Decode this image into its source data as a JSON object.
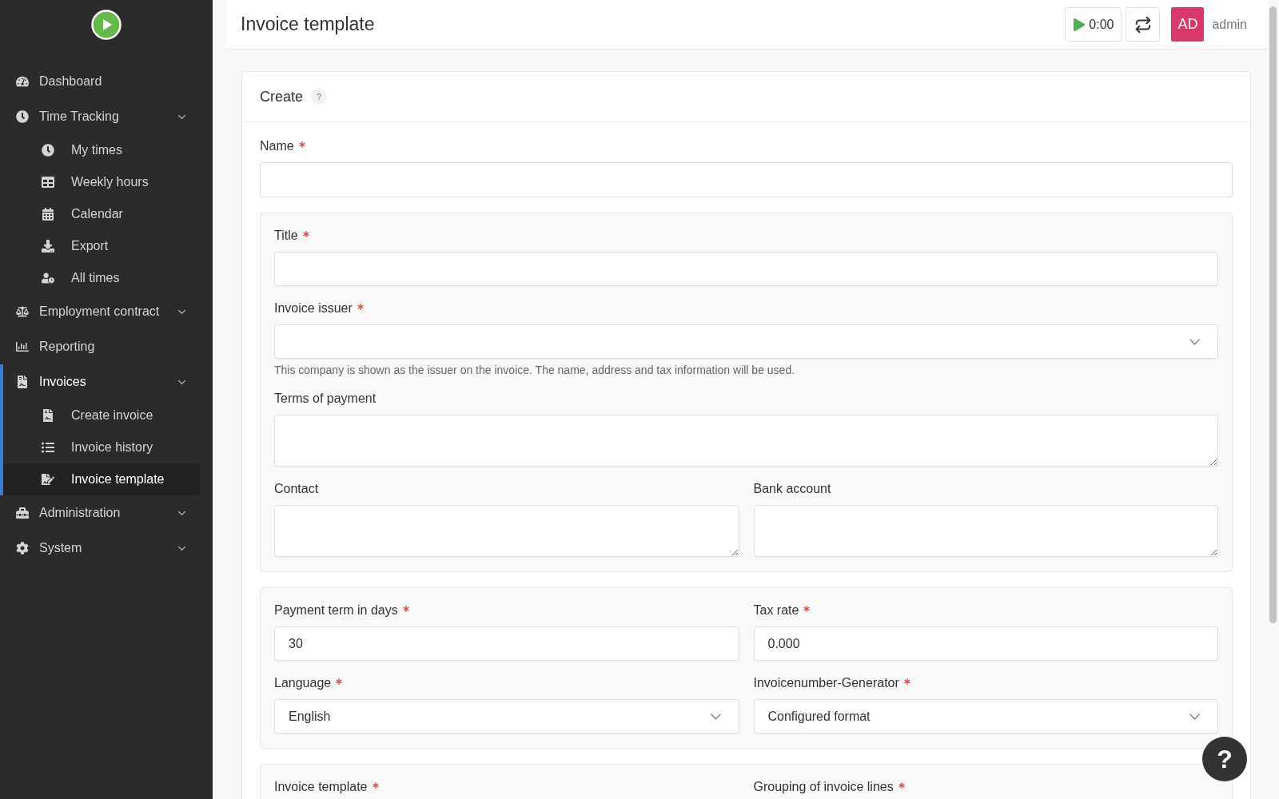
{
  "sidebar": {
    "items": [
      {
        "label": "Dashboard",
        "kind": "link",
        "selected": false
      },
      {
        "label": "Time Tracking",
        "kind": "group",
        "selected": false,
        "children": [
          {
            "label": "My times",
            "selected": false
          },
          {
            "label": "Weekly hours",
            "selected": false
          },
          {
            "label": "Calendar",
            "selected": false
          },
          {
            "label": "Export",
            "selected": false
          },
          {
            "label": "All times",
            "selected": false
          }
        ]
      },
      {
        "label": "Employment contract",
        "kind": "group",
        "selected": false
      },
      {
        "label": "Reporting",
        "kind": "link",
        "selected": false
      },
      {
        "label": "Invoices",
        "kind": "group",
        "selected": true,
        "children": [
          {
            "label": "Create invoice",
            "selected": false
          },
          {
            "label": "Invoice history",
            "selected": false
          },
          {
            "label": "Invoice template",
            "selected": true
          }
        ]
      },
      {
        "label": "Administration",
        "kind": "group",
        "selected": false
      },
      {
        "label": "System",
        "kind": "group",
        "selected": false
      }
    ]
  },
  "header": {
    "title": "Invoice template",
    "timer": "0:00",
    "avatar": "AD",
    "username": "admin"
  },
  "form": {
    "title": "Create",
    "help_badge": "?",
    "fields": [
      {
        "kind": "text",
        "label": "Name",
        "required": true
      }
    ],
    "groups": [
      {
        "rows": [
          [
            {
              "kind": "text",
              "label": "Title",
              "required": true
            }
          ],
          [
            {
              "kind": "select",
              "label": "Invoice issuer",
              "required": true,
              "help": "This company is shown as the issuer on the invoice. The name, address and tax information will be used."
            }
          ],
          [
            {
              "kind": "textarea",
              "label": "Terms of payment",
              "required": false
            }
          ],
          [
            {
              "kind": "textarea",
              "label": "Contact",
              "required": false
            },
            {
              "kind": "textarea",
              "label": "Bank account",
              "required": false
            }
          ]
        ]
      },
      {
        "rows": [
          [
            {
              "kind": "text",
              "label": "Payment term in days",
              "required": true,
              "value": "30"
            },
            {
              "kind": "text",
              "label": "Tax rate",
              "required": true,
              "value": "0.000"
            }
          ],
          [
            {
              "kind": "select",
              "label": "Language",
              "required": true,
              "value": "English"
            },
            {
              "kind": "select",
              "label": "Invoicenumber-Generator",
              "required": true,
              "value": "Configured format"
            }
          ]
        ]
      },
      {
        "rows": [
          [
            {
              "kind": "partial",
              "label": "Invoice template",
              "required": true
            },
            {
              "kind": "partial",
              "label": "Grouping of invoice lines",
              "required": true
            }
          ]
        ]
      }
    ]
  },
  "help_button": "?"
}
